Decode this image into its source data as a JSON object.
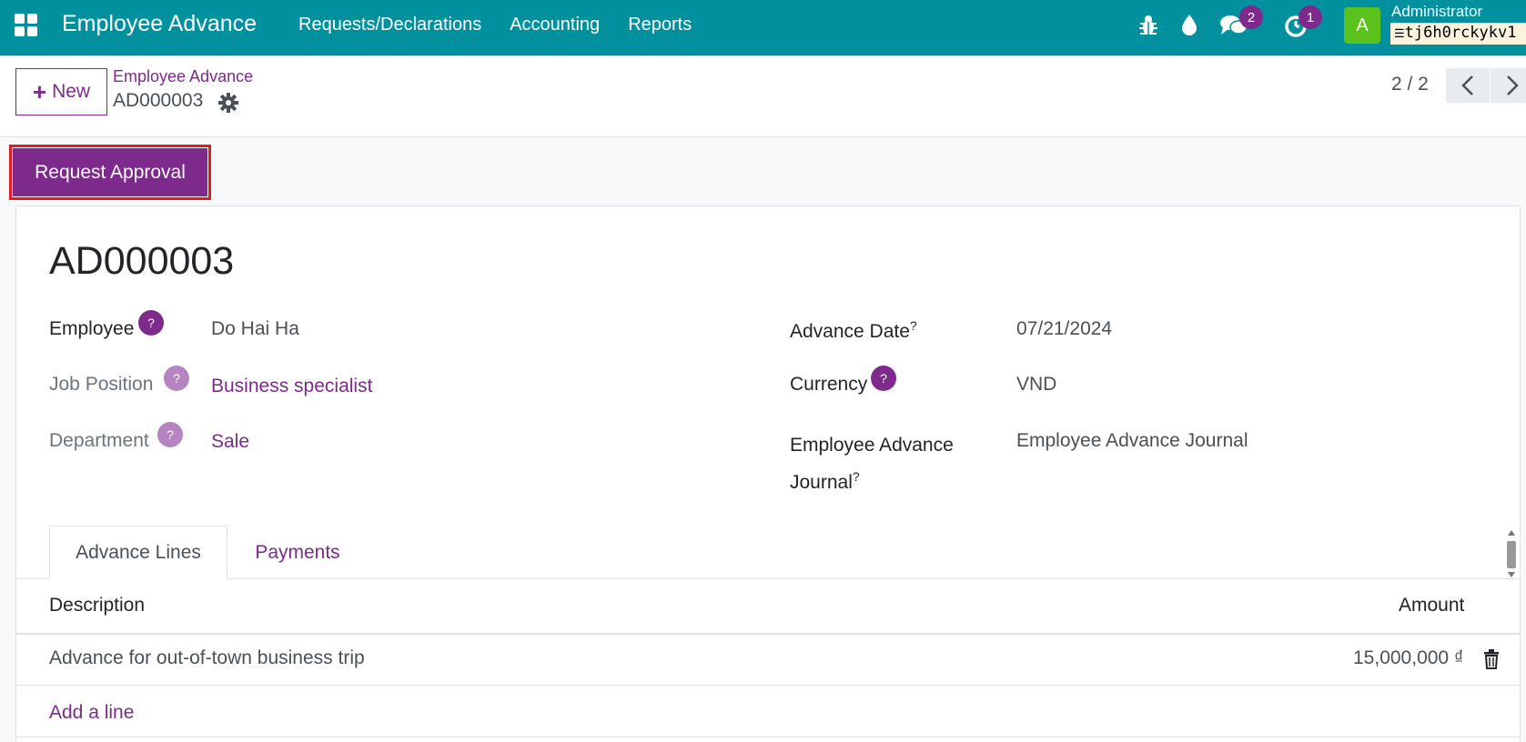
{
  "navbar": {
    "brand": "Employee Advance",
    "menu": [
      "Requests/Declarations",
      "Accounting",
      "Reports"
    ],
    "messages_badge": "2",
    "activities_badge": "1",
    "avatar_letter": "A",
    "user_name": "Administrator",
    "db_name": "tj6h0rckykv1"
  },
  "control_panel": {
    "new_label": "New",
    "breadcrumb": "Employee Advance",
    "record_name": "AD000003",
    "pager_value": "2 / 2"
  },
  "status_bar": {
    "request_approval_label": "Request Approval"
  },
  "form": {
    "title": "AD000003",
    "employee_label": "Employee",
    "employee_value": "Do Hai Ha",
    "job_position_label": "Job Position",
    "job_position_value": "Business specialist",
    "department_label": "Department",
    "department_value": "Sale",
    "advance_date_label": "Advance Date",
    "advance_date_value": "07/21/2024",
    "currency_label": "Currency",
    "currency_value": "VND",
    "journal_label_line1": "Employee Advance",
    "journal_label_line2": "Journal",
    "journal_value": "Employee Advance Journal",
    "help_mark": "?"
  },
  "tabs": {
    "advance_lines": "Advance Lines",
    "payments": "Payments"
  },
  "table": {
    "headers": {
      "description": "Description",
      "amount": "Amount"
    },
    "rows": [
      {
        "description": "Advance for out-of-town business trip",
        "amount": "15,000,000 ₫"
      }
    ],
    "add_line": "Add a line"
  },
  "colors": {
    "navbar": "#01919e",
    "primary": "#7d2a8c",
    "highlight": "#e01b24",
    "avatar": "#5bc21d"
  }
}
